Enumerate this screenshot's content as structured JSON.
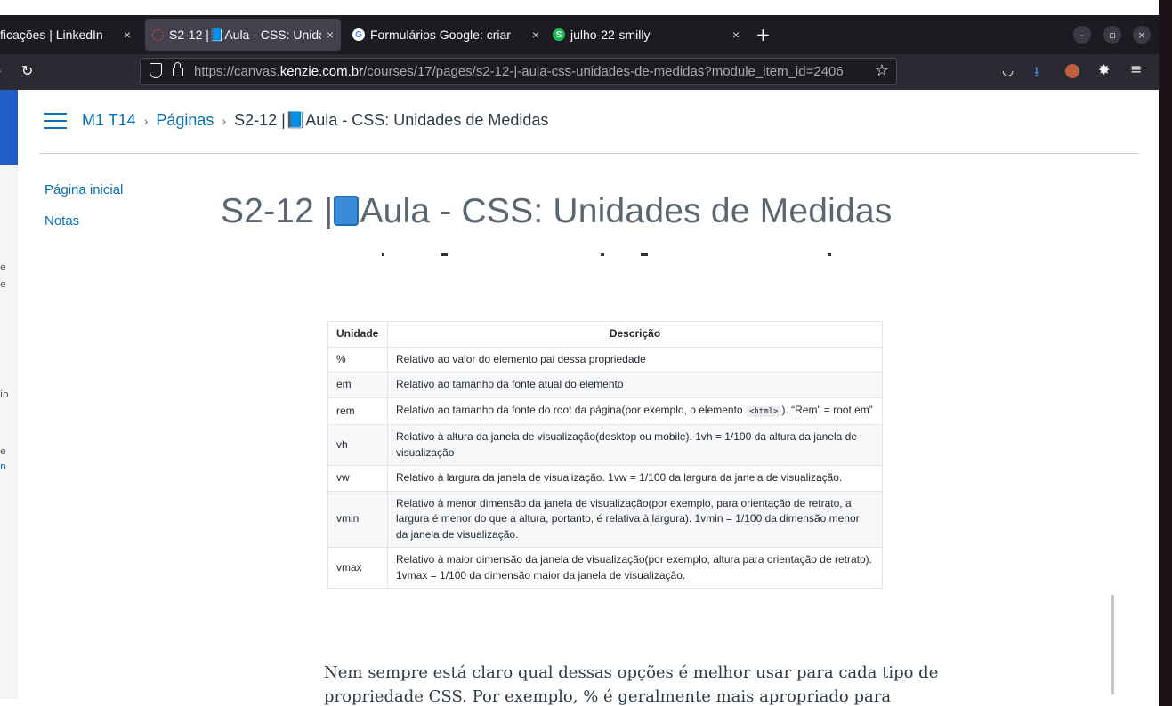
{
  "browser": {
    "tabs": [
      {
        "title": "ficações | LinkedIn",
        "active": false,
        "favicon": "none"
      },
      {
        "title": "S2-12 |📘Aula - CSS: Unida",
        "active": true,
        "favicon": "loading-icon"
      },
      {
        "title": "Formulários Google: criar",
        "active": false,
        "favicon": "google-icon"
      },
      {
        "title": "julho-22-smilly",
        "active": false,
        "favicon": "s-icon"
      }
    ],
    "close_glyph": "×",
    "new_tab_glyph": "+",
    "url_prefix": "https://canvas.",
    "url_domain": "kenzie.com.br",
    "url_suffix": "/courses/17/pages/s2-12-|-aula-css-unidades-de-medidas?module_item_id=2406",
    "window_controls": [
      "–",
      "▫",
      "×"
    ]
  },
  "breadcrumb": {
    "course": "M1 T14",
    "section": "Páginas",
    "current": "S2-12 |📘Aula - CSS: Unidades de Medidas"
  },
  "leftnav": {
    "items": [
      "Página inicial",
      "Notas"
    ]
  },
  "page": {
    "title_prefix": "S2-12 |",
    "title_suffix": "Aula - CSS: Unidades de Medidas"
  },
  "table": {
    "headers": [
      "Unidade",
      "Descrição"
    ],
    "rows": [
      {
        "unit": "%",
        "desc": "Relativo ao valor do elemento pai dessa propriedade"
      },
      {
        "unit": "em",
        "desc": "Relativo ao tamanho da fonte atual do elemento"
      },
      {
        "unit": "rem",
        "desc_before": "Relativo ao tamanho da fonte do root da página(por exemplo, o elemento ",
        "desc_code": "<html>",
        "desc_after": "). “Rem” = root em”"
      },
      {
        "unit": "vh",
        "desc": "Relativo à altura da janela de visualização(desktop ou mobile). 1vh = 1/100 da altura da janela de visualização"
      },
      {
        "unit": "vw",
        "desc": "Relativo à largura da janela de visualização. 1vw = 1/100 da largura da janela de visualização."
      },
      {
        "unit": "vmin",
        "desc": "Relativo à menor dimensão da janela de visualização(por exemplo, para orientação de retrato, a largura é menor do que a altura, portanto, é relativa à largura). 1vmin = 1/100 da dimensão menor da janela de visualização."
      },
      {
        "unit": "vmax",
        "desc": "Relativo à maior dimensão da janela de visualização(por exemplo, altura para orientação de retrato). 1vmax = 1/100 da dimensão maior da janela de visualização."
      }
    ]
  },
  "paragraph": "Nem sempre está claro qual dessas opções é melhor usar para cada tipo de propriedade CSS. Por exemplo, % é geralmente mais apropriado para propriedades relacionadas ao",
  "left_fragments": [
    "e",
    "e",
    "io",
    "e",
    "n"
  ]
}
